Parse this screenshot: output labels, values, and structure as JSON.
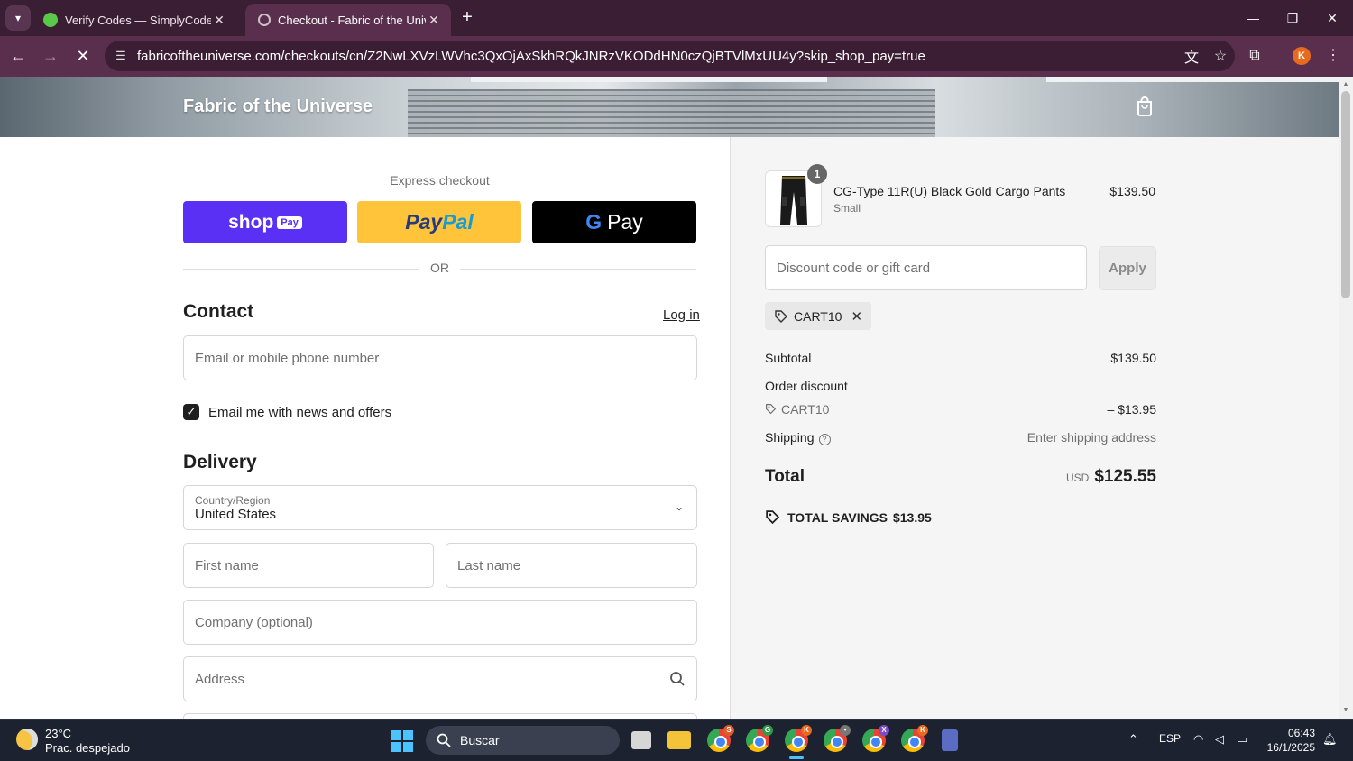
{
  "browser": {
    "tabs": [
      {
        "title": "Verify Codes — SimplyCodes",
        "active": false
      },
      {
        "title": "Checkout - Fabric of the Univers",
        "active": true
      }
    ],
    "url": "fabricoftheuniverse.com/checkouts/cn/Z2NwLXVzLWVhc3QxOjAxSkhRQkJNRzVKODdHN0czQjBTVlMxUU4y?skip_shop_pay=true",
    "profile_initial": "K"
  },
  "store": {
    "name": "Fabric of the Universe"
  },
  "checkout": {
    "express_label": "Express checkout",
    "shop_pay": {
      "brand": "shop",
      "badge": "Pay"
    },
    "paypal": {
      "pay": "Pay",
      "pal": "Pal"
    },
    "gpay": {
      "g": "G",
      "pay": "Pay"
    },
    "or_label": "OR",
    "contact": {
      "title": "Contact",
      "login_label": "Log in",
      "email_placeholder": "Email or mobile phone number",
      "newsletter_label": "Email me with news and offers",
      "newsletter_checked": true
    },
    "delivery": {
      "title": "Delivery",
      "country_label": "Country/Region",
      "country_value": "United States",
      "first_name_placeholder": "First name",
      "last_name_placeholder": "Last name",
      "company_placeholder": "Company (optional)",
      "address_placeholder": "Address"
    }
  },
  "summary": {
    "product": {
      "quantity": "1",
      "name": "CG-Type 11R(U) Black Gold Cargo Pants",
      "variant": "Small",
      "price": "$139.50"
    },
    "discount_placeholder": "Discount code or gift card",
    "apply_label": "Apply",
    "applied_code": "CART10",
    "subtotal_label": "Subtotal",
    "subtotal_value": "$139.50",
    "order_discount_label": "Order discount",
    "discount_code": "CART10",
    "discount_value": "– $13.95",
    "shipping_label": "Shipping",
    "shipping_value": "Enter shipping address",
    "total_label": "Total",
    "total_currency": "USD",
    "total_value": "$125.55",
    "savings_label": "TOTAL SAVINGS",
    "savings_value": "$13.95"
  },
  "taskbar": {
    "temperature": "23°C",
    "weather": "Prac. despejado",
    "search_label": "Buscar",
    "language": "ESP",
    "time": "06:43",
    "date": "16/1/2025"
  },
  "colors": {
    "shop_pay": "#5a31f4",
    "paypal": "#ffc439",
    "gpay": "#000000",
    "chrome_frame": "#3a1e33"
  }
}
